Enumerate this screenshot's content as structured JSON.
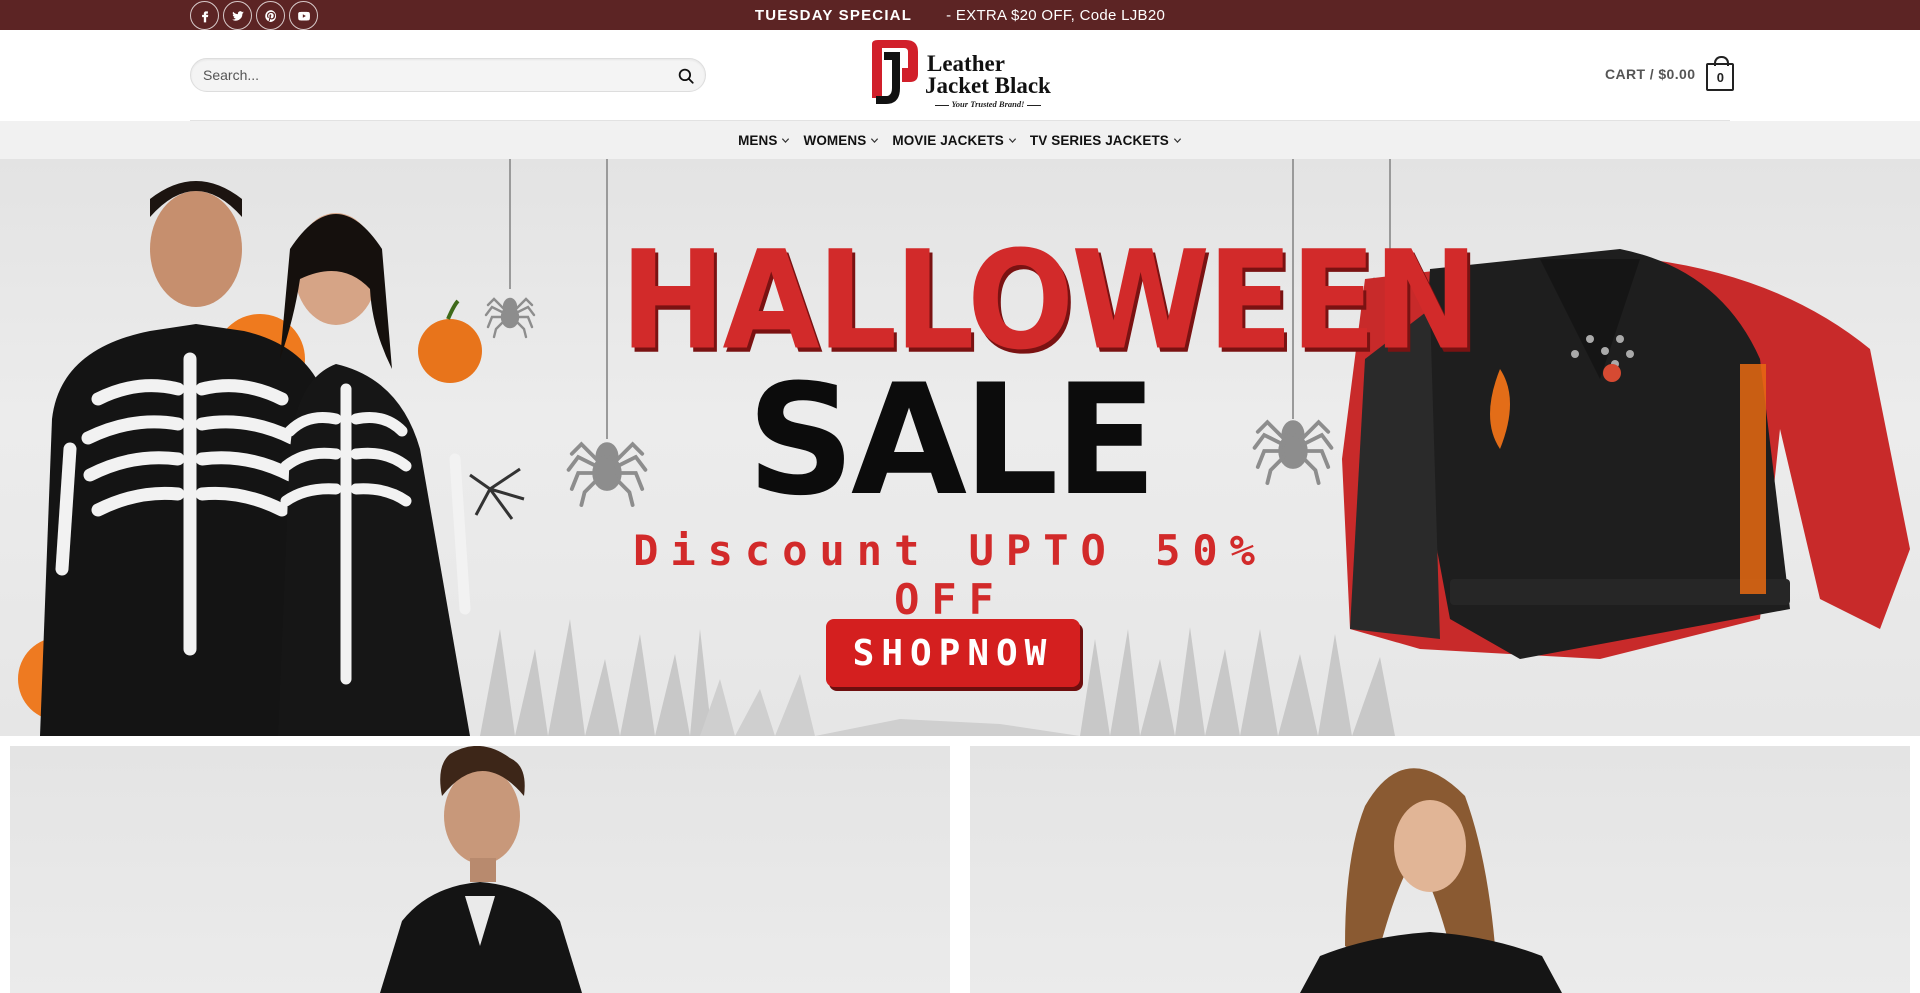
{
  "topbar": {
    "social": [
      {
        "name": "facebook",
        "glyph": "f"
      },
      {
        "name": "twitter",
        "glyph": "t"
      },
      {
        "name": "pinterest",
        "glyph": "p"
      },
      {
        "name": "youtube",
        "glyph": "y"
      }
    ],
    "promo_title": "TUESDAY SPECIAL",
    "promo_text": "- EXTRA $20 OFF, Code LJB20",
    "bg_color": "#5c2424"
  },
  "header": {
    "search_placeholder": "Search...",
    "logo": {
      "line1": "Leather",
      "line2": "Jacket Black",
      "tagline": "Your Trusted Brand!"
    },
    "cart_label": "CART / $0.00",
    "cart_count": "0"
  },
  "nav": {
    "items": [
      {
        "label": "MENS"
      },
      {
        "label": "WOMENS"
      },
      {
        "label": "MOVIE JACKETS"
      },
      {
        "label": "TV SERIES JACKETS"
      }
    ]
  },
  "hero": {
    "title": "HALLOWEEN",
    "subtitle": "SALE",
    "discount": "Discount UPTO 50% OFF",
    "cta": "SHOPNOW",
    "accent_color": "#d22a2a"
  },
  "tiles": [
    {
      "name": "mens-category"
    },
    {
      "name": "womens-category"
    }
  ]
}
